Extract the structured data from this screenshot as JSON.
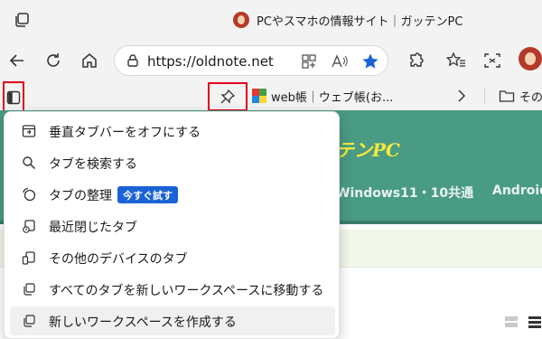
{
  "window": {
    "tab_title": "PCやスマホの情報サイト｜ガッテンPC"
  },
  "toolbar": {
    "url": "https://oldnote.net"
  },
  "favorites_bar": {
    "item1_label": "web帳｜ウェブ帳(お...",
    "folder_label": "その他"
  },
  "page": {
    "brand": "テンPC",
    "nav_item": "Windows11・10共通",
    "nav_item2": "Android"
  },
  "menu": {
    "items": [
      {
        "label": "垂直タブバーをオフにする",
        "icon": "vertical-tabs-off-icon"
      },
      {
        "label": "タブを検索する",
        "icon": "search-icon"
      },
      {
        "label": "タブの整理",
        "icon": "organize-tabs-icon",
        "badge": "今すぐ試す"
      },
      {
        "label": "最近閉じたタブ",
        "icon": "recently-closed-icon"
      },
      {
        "label": "その他のデバイスのタブ",
        "icon": "other-devices-icon"
      },
      {
        "label": "すべてのタブを新しいワークスペースに移動する",
        "icon": "workspace-move-icon"
      },
      {
        "label": "新しいワークスペースを作成する",
        "icon": "workspace-create-icon"
      }
    ]
  },
  "colors": {
    "highlight_border": "#e0001a",
    "site_header": "#4a9b84",
    "brand_yellow": "#f3ea3a",
    "badge_blue": "#1a63d6"
  }
}
